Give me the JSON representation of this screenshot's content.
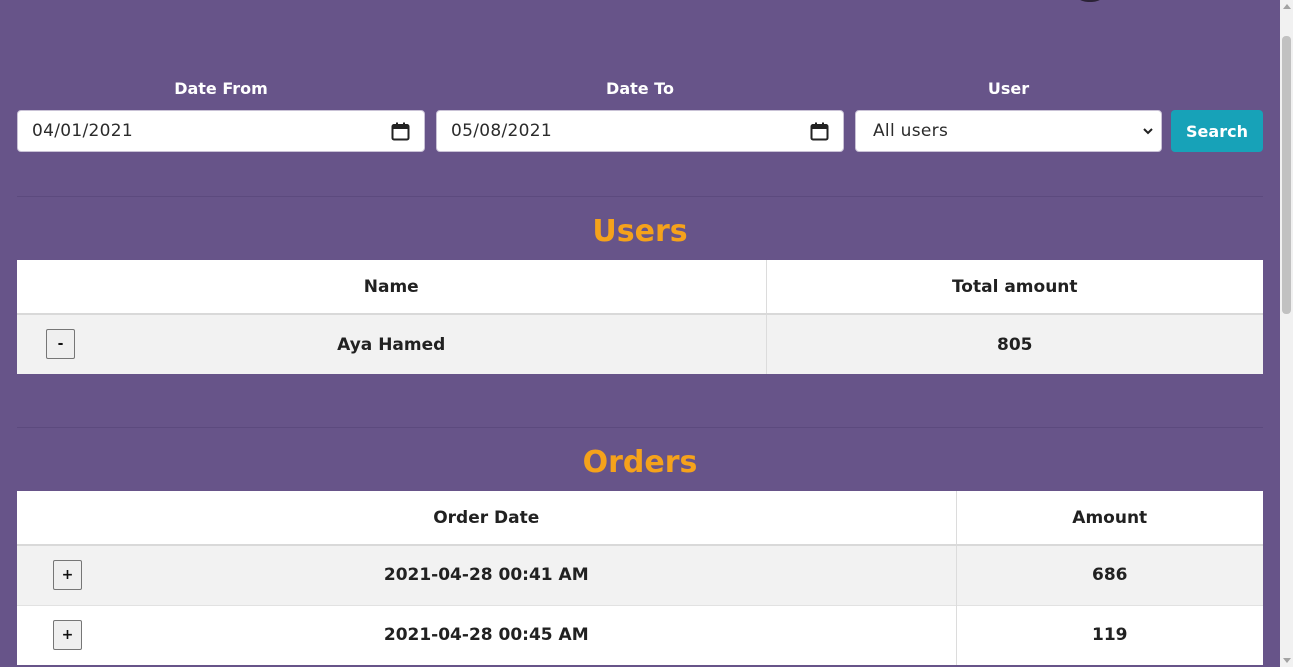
{
  "filters": {
    "date_from": {
      "label": "Date From",
      "value": "04/01/2021"
    },
    "date_to": {
      "label": "Date To",
      "value": "05/08/2021"
    },
    "user": {
      "label": "User",
      "selected": "All users"
    },
    "search_label": "Search"
  },
  "users_section": {
    "title": "Users",
    "columns": [
      "Name",
      "Total amount"
    ],
    "rows": [
      {
        "toggle": "-",
        "name": "Aya Hamed",
        "total": "805"
      }
    ]
  },
  "orders_section": {
    "title": "Orders",
    "columns": [
      "Order Date",
      "Amount"
    ],
    "rows": [
      {
        "toggle": "+",
        "date": "2021-04-28 00:41 AM",
        "amount": "686"
      },
      {
        "toggle": "+",
        "date": "2021-04-28 00:45 AM",
        "amount": "119"
      }
    ]
  },
  "colors": {
    "background": "#675489",
    "accent": "#f5a21b",
    "search_button": "#17a2b8"
  },
  "icons": {
    "date_picker": "calendar-icon",
    "select": "chevron-down-icon"
  }
}
